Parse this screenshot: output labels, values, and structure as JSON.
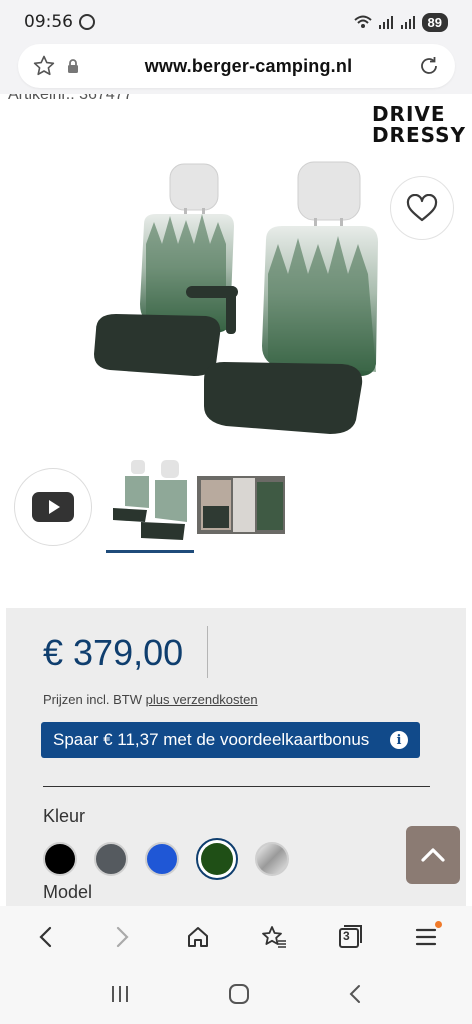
{
  "status_bar": {
    "time": "09:56",
    "battery": "89"
  },
  "url_bar": {
    "url": "www.berger-camping.nl"
  },
  "product": {
    "artikel_partial": "Artikelnr.: 367477",
    "brand_line1": "DRIVE",
    "brand_line2": "DRESSY"
  },
  "pricing": {
    "price": "€ 379,00",
    "vat_note": "Prijzen incl. BTW",
    "shipping_link": "plus verzendkosten",
    "bonus_text": "Spaar € 11,37 met de voordeelkaartbonus",
    "info_glyph": "i"
  },
  "options": {
    "color_label": "Kleur",
    "colors": [
      {
        "name": "black",
        "hex": "#000000"
      },
      {
        "name": "grey",
        "hex": "#555a5f"
      },
      {
        "name": "blue",
        "hex": "#1f57d6"
      },
      {
        "name": "green",
        "hex": "#1f4f16",
        "selected": true
      },
      {
        "name": "silver",
        "hex": "#c8c8c8"
      }
    ],
    "model_label": "Model"
  },
  "browser_nav": {
    "tab_count": "3"
  },
  "colors": {
    "accent": "#0f3e6e",
    "bonus_bg": "#114a8a",
    "scroll_top_bg": "#8b7b73"
  }
}
